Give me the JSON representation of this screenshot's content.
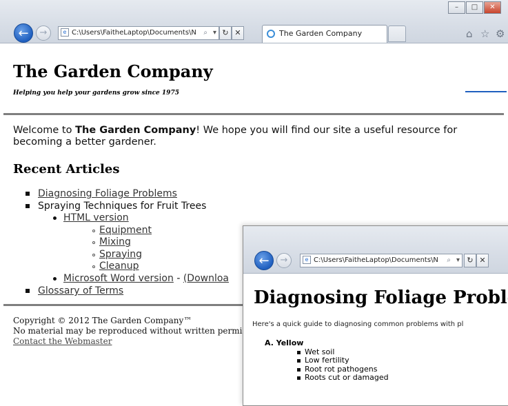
{
  "window1": {
    "address": "C:\\Users\\FaitheLaptop\\Documents\\N",
    "tab_title": "The Garden Company",
    "site_title": "The Garden Company",
    "tagline": "Helping you help your gardens grow since 1975",
    "welcome_prefix": "Welcome to ",
    "welcome_bold": "The Garden Company",
    "welcome_suffix": "! We hope you will find our site a useful resource for becoming a better gardener.",
    "recent_heading": "Recent Articles",
    "articles": {
      "item1": "Diagnosing Foliage Problems",
      "item2": "Spraying Techniques for Fruit Trees",
      "html_version": "HTML version",
      "sub": [
        "Equipment",
        "Mixing",
        "Spraying",
        "Cleanup"
      ],
      "word_version": "Microsoft Word version",
      "dash": " - ",
      "download": "(Downloa",
      "item3": "Glossary of Terms"
    },
    "footer": {
      "copyright": "Copyright © 2012 The Garden Company™",
      "notice": "No material may be reproduced without written permiss",
      "contact": "Contact the Webmaster"
    },
    "captions": {
      "minimize": "–",
      "maximize": "□",
      "close": "✕"
    }
  },
  "window2": {
    "address": "C:\\Users\\FaitheLaptop\\Documents\\N",
    "title": "Diagnosing Foliage Problems",
    "intro": "Here's a quick guide to diagnosing common problems with pl",
    "section_label": "A.",
    "section": "Yellow",
    "causes": [
      "Wet soil",
      "Low fertility",
      "Root rot pathogens",
      "Roots cut or damaged"
    ]
  },
  "icons": {
    "back": "←",
    "forward": "→",
    "search": "⌕",
    "dropdown": "▾",
    "refresh": "↻",
    "stop": "✕",
    "home": "⌂",
    "favorites": "☆",
    "tools": "⚙"
  },
  "colors": {
    "accent": "#1f5fbf",
    "rule": "#7f7f7f"
  }
}
